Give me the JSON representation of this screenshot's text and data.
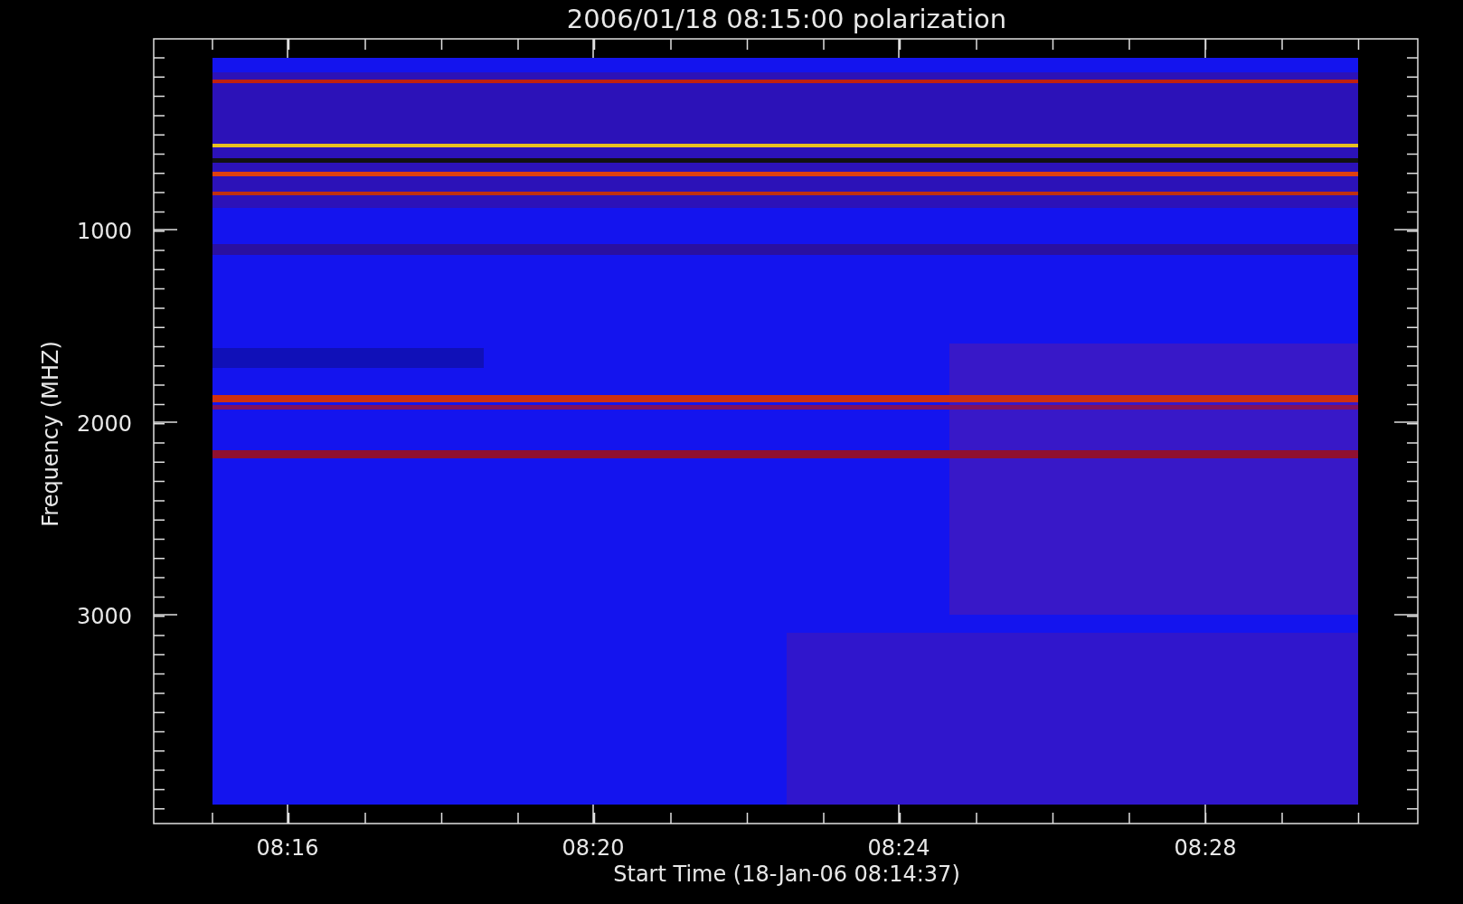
{
  "title": "2006/01/18 08:15:00 polarization",
  "y_axis": {
    "label": "Frequency (MHZ)",
    "ticks": [
      "1000",
      "2000",
      "3000"
    ]
  },
  "x_axis": {
    "label": "Start Time (18-Jan-06 08:14:37)",
    "ticks": [
      "08:16",
      "08:20",
      "08:24",
      "08:28"
    ]
  }
}
